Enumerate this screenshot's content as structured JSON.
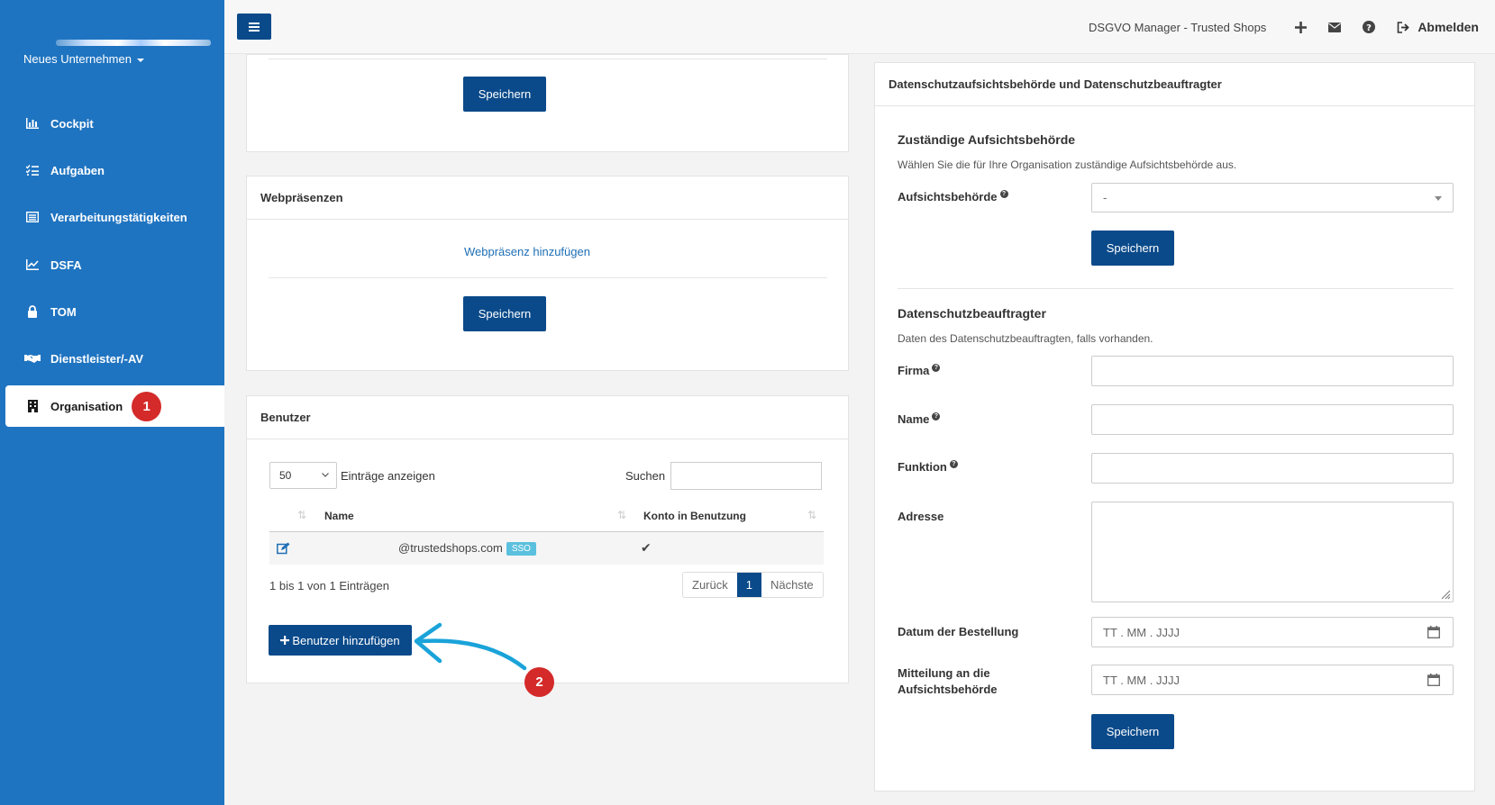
{
  "sidebar": {
    "company": "Neues Unternehmen",
    "items": [
      {
        "label": "Cockpit",
        "icon": "bar-chart-icon"
      },
      {
        "label": "Aufgaben",
        "icon": "tasks-icon"
      },
      {
        "label": "Verarbeitungstätigkeiten",
        "icon": "list-icon"
      },
      {
        "label": "DSFA",
        "icon": "line-chart-icon"
      },
      {
        "label": "TOM",
        "icon": "lock-icon"
      },
      {
        "label": "Dienstleister/-AV",
        "icon": "handshake-icon"
      },
      {
        "label": "Organisation",
        "icon": "building-icon",
        "active": true,
        "badge": "1"
      }
    ]
  },
  "topbar": {
    "title": "DSGVO Manager - Trusted Shops",
    "logout": "Abmelden"
  },
  "panel_top": {
    "save": "Speichern"
  },
  "web": {
    "title": "Webpräsenzen",
    "add_link": "Webpräsenz hinzufügen",
    "save": "Speichern"
  },
  "users": {
    "title": "Benutzer",
    "page_size": "50",
    "page_size_label": "Einträge anzeigen",
    "search_label": "Suchen",
    "columns": [
      "Name",
      "Konto in Benutzung"
    ],
    "rows": [
      {
        "name": "@trustedshops.com",
        "tag": "SSO",
        "in_use": "✔"
      }
    ],
    "info": "1 bis 1 von 1 Einträgen",
    "prev": "Zurück",
    "page": "1",
    "next": "Nächste",
    "add_button": "Benutzer hinzufügen",
    "annotation": "2"
  },
  "dpo_panel": {
    "title": "Datenschutzaufsichtsbehörde und Datenschutzbeauftragter",
    "authority": {
      "title": "Zuständige Aufsichtsbehörde",
      "desc": "Wählen Sie die für Ihre Organisation zuständige Aufsichtsbehörde aus.",
      "label": "Aufsichtsbehörde",
      "value": "-",
      "save": "Speichern"
    },
    "dpo": {
      "title": "Datenschutzbeauftragter",
      "desc": "Daten des Datenschutzbeauftragten, falls vorhanden.",
      "firma": "Firma",
      "name": "Name",
      "funktion": "Funktion",
      "adresse": "Adresse",
      "datum": "Datum der Bestellung",
      "datum_placeholder": "TT . MM . JJJJ",
      "mitteilung": "Mitteilung an die Aufsichtsbehörde",
      "mitteilung_placeholder": "TT . MM . JJJJ",
      "save": "Speichern"
    }
  },
  "colors": {
    "sidebar": "#1f74c1",
    "primary": "#0a4a8a",
    "badge": "#d42a2a",
    "arrow": "#1aa3d9"
  }
}
